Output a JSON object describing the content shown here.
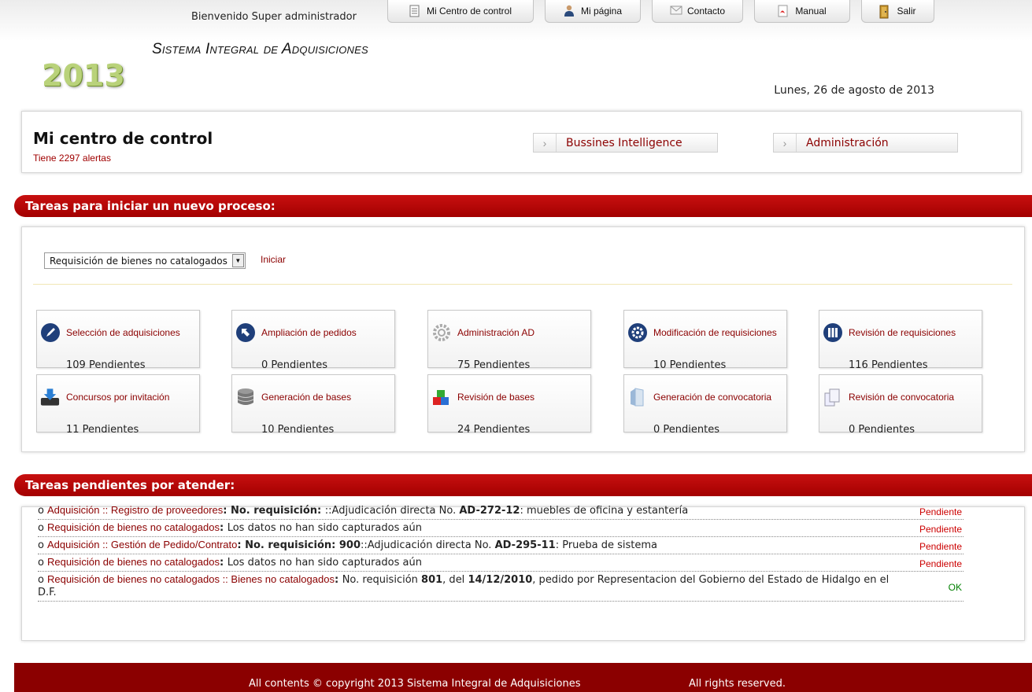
{
  "header": {
    "welcome": "Bienvenido Super administrador",
    "nav": [
      {
        "label": "Mi Centro de control",
        "icon": "document-icon"
      },
      {
        "label": "Mi página",
        "icon": "user-icon"
      },
      {
        "label": "Contacto",
        "icon": "envelope-icon"
      },
      {
        "label": "Manual",
        "icon": "pdf-icon"
      },
      {
        "label": "Salir",
        "icon": "door-exit-icon"
      }
    ],
    "system_title": "Sistema Integral de Adquisiciones",
    "year": "2013",
    "date": "Lunes, 26 de agosto de 2013"
  },
  "control": {
    "title": "Mi centro de control",
    "alerts": "Tiene 2297 alertas",
    "links": [
      {
        "label": "Bussines Intelligence"
      },
      {
        "label": "Administración"
      }
    ]
  },
  "new_process": {
    "heading": "Tareas para iniciar un nuevo proceso:",
    "select_value": "Requisición de bienes no catalogados",
    "start_label": "Iniciar",
    "tiles": [
      {
        "label": "Selección de adquisiciones",
        "count": "109 Pendientes",
        "icon": "pen-icon"
      },
      {
        "label": "Ampliación de pedidos",
        "count": "0 Pendientes",
        "icon": "arrow-up-left-icon"
      },
      {
        "label": "Administración AD",
        "count": "75 Pendientes",
        "icon": "gear-icon"
      },
      {
        "label": "Modificación de requisiciones",
        "count": "10 Pendientes",
        "icon": "gear-circle-icon"
      },
      {
        "label": "Revisión de requisiciones",
        "count": "116 Pendientes",
        "icon": "books-icon"
      },
      {
        "label": "Concursos por invitación",
        "count": "11 Pendientes",
        "icon": "download-tray-icon"
      },
      {
        "label": "Generación de bases",
        "count": "10 Pendientes",
        "icon": "database-icon"
      },
      {
        "label": "Revisión de bases",
        "count": "24 Pendientes",
        "icon": "blocks-icon"
      },
      {
        "label": "Generación de convocatoria",
        "count": "0 Pendientes",
        "icon": "folder-icon"
      },
      {
        "label": "Revisión de convocatoria",
        "count": "0 Pendientes",
        "icon": "documents-icon"
      }
    ]
  },
  "pending": {
    "heading": "Tareas pendientes por atender:",
    "rows": [
      {
        "bullet": "o",
        "link": "Adquisición :: Registro de proveedores",
        "parts": [
          {
            "text": ": No. requisición: ",
            "bold": true
          },
          {
            "text": "::Adjudicación directa No. ",
            "bold": false
          },
          {
            "text": "AD-272-12",
            "bold": true
          },
          {
            "text": ": muebles de oficina y estantería",
            "bold": false
          }
        ],
        "status": "Pendiente"
      },
      {
        "bullet": "o",
        "link": "Requisición de bienes no catalogados",
        "parts": [
          {
            "text": ": ",
            "bold": true
          },
          {
            "text": "Los datos no han sido capturados aún",
            "bold": false
          }
        ],
        "status": "Pendiente"
      },
      {
        "bullet": "o",
        "link": "Adquisición :: Gestión de Pedido/Contrato",
        "parts": [
          {
            "text": ": No. requisición: 900",
            "bold": true
          },
          {
            "text": "::Adjudicación directa No. ",
            "bold": false
          },
          {
            "text": "AD-295-11",
            "bold": true
          },
          {
            "text": ": Prueba de sistema",
            "bold": false
          }
        ],
        "status": "Pendiente"
      },
      {
        "bullet": "o",
        "link": "Requisición de bienes no catalogados",
        "parts": [
          {
            "text": ": ",
            "bold": true
          },
          {
            "text": "Los datos no han sido capturados aún",
            "bold": false
          }
        ],
        "status": "Pendiente"
      },
      {
        "bullet": "o",
        "link": "Requisición de bienes no catalogados :: Bienes no catalogados",
        "parts": [
          {
            "text": ": ",
            "bold": true
          },
          {
            "text": "No. requisición ",
            "bold": false
          },
          {
            "text": "801",
            "bold": true
          },
          {
            "text": ", del ",
            "bold": false
          },
          {
            "text": "14/12/2010",
            "bold": true
          },
          {
            "text": ", pedido por Representacion del Gobierno del Estado de Hidalgo en el D.F.",
            "bold": false
          }
        ],
        "status": "OK"
      }
    ]
  },
  "footer": {
    "copyright": "All contents © copyright 2013 Sistema Integral de Adquisiciones",
    "rights": "All rights reserved."
  },
  "colors": {
    "brand_red": "#a30000",
    "link_red": "#8b0000",
    "status_pending": "#cc0000",
    "status_ok": "#008000"
  }
}
